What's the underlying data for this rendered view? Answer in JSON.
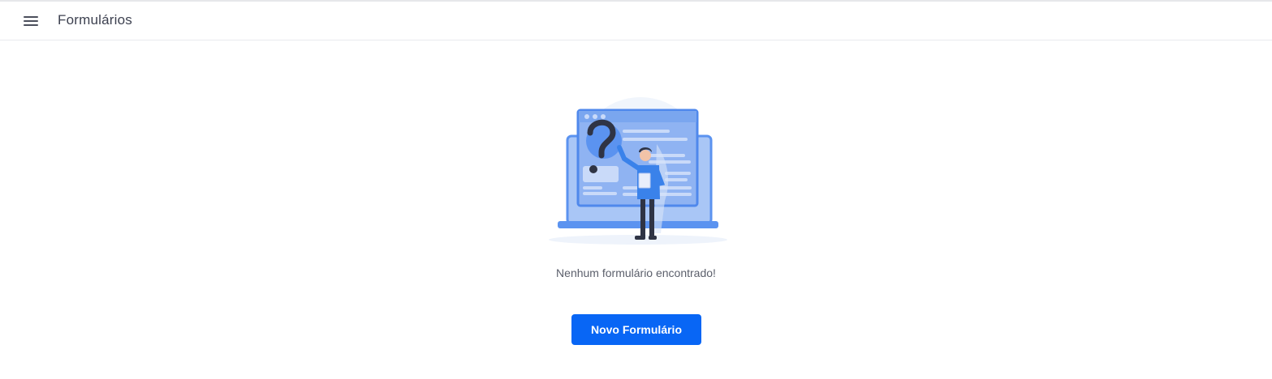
{
  "header": {
    "menu_icon": "hamburger-menu-icon",
    "title": "Formulários"
  },
  "empty_state": {
    "illustration": "question-mark-laptop-person-illustration",
    "message": "Nenhum formulário encontrado!",
    "new_button_label": "Novo Formulário"
  },
  "colors": {
    "primary": "#0866f5",
    "illustration_blue": "#5b93f0",
    "text": "#3d4150"
  }
}
